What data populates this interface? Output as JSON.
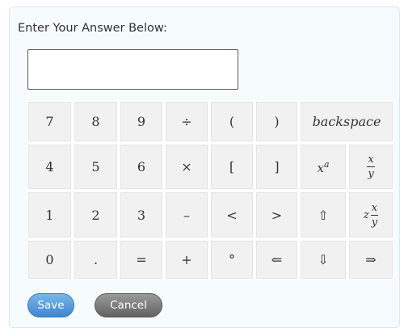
{
  "prompt": "Enter Your Answer Below:",
  "answer": {
    "value": "",
    "placeholder": ""
  },
  "keypad": {
    "rows": [
      [
        {
          "name": "key-7",
          "label": "7"
        },
        {
          "name": "key-8",
          "label": "8"
        },
        {
          "name": "key-9",
          "label": "9"
        },
        {
          "name": "key-divide",
          "label": "÷"
        },
        {
          "name": "key-open-paren",
          "label": "("
        },
        {
          "name": "key-close-paren",
          "label": ")"
        },
        {
          "name": "key-backspace",
          "label": "backspace",
          "italic": true,
          "span": 2
        }
      ],
      [
        {
          "name": "key-4",
          "label": "4"
        },
        {
          "name": "key-5",
          "label": "5"
        },
        {
          "name": "key-6",
          "label": "6"
        },
        {
          "name": "key-multiply",
          "label": "×"
        },
        {
          "name": "key-open-bracket",
          "label": "["
        },
        {
          "name": "key-close-bracket",
          "label": "]"
        },
        {
          "name": "key-exponent",
          "type": "power",
          "base": "x",
          "exp": "a"
        },
        {
          "name": "key-fraction",
          "type": "fraction",
          "num": "x",
          "den": "y"
        }
      ],
      [
        {
          "name": "key-1",
          "label": "1"
        },
        {
          "name": "key-2",
          "label": "2"
        },
        {
          "name": "key-3",
          "label": "3"
        },
        {
          "name": "key-minus",
          "label": "–"
        },
        {
          "name": "key-less-than",
          "label": "<"
        },
        {
          "name": "key-greater-than",
          "label": ">"
        },
        {
          "name": "key-arrow-up",
          "label": "⇧"
        },
        {
          "name": "key-mixed-fraction",
          "type": "mixed",
          "whole": "z",
          "num": "x",
          "den": "y"
        }
      ],
      [
        {
          "name": "key-0",
          "label": "0"
        },
        {
          "name": "key-decimal",
          "label": "."
        },
        {
          "name": "key-equals",
          "label": "="
        },
        {
          "name": "key-plus",
          "label": "+"
        },
        {
          "name": "key-degree",
          "label": "°"
        },
        {
          "name": "key-arrow-left",
          "label": "⇐"
        },
        {
          "name": "key-arrow-down",
          "label": "⇩"
        },
        {
          "name": "key-arrow-right",
          "label": "⇒"
        }
      ]
    ]
  },
  "buttons": {
    "save": "Save",
    "cancel": "Cancel"
  }
}
